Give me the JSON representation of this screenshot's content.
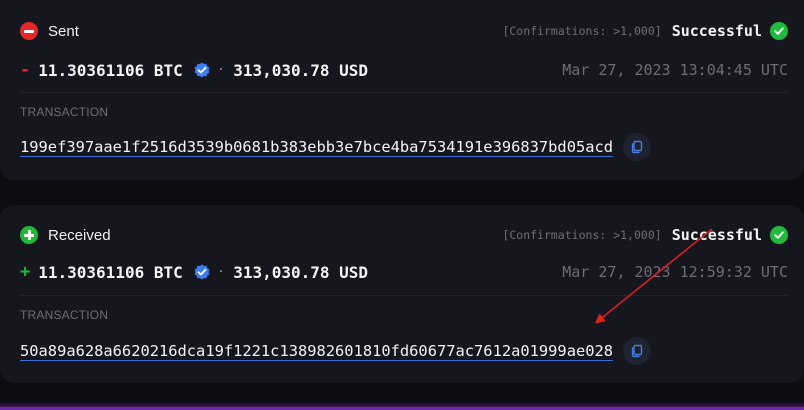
{
  "transactions": [
    {
      "direction_label": "Sent",
      "direction": "sent",
      "confirmations": "[Confirmations: >1,000]",
      "status": "Successful",
      "sign": "-",
      "amount": "11.30361106 BTC",
      "separator": "·",
      "fiat": "313,030.78 USD",
      "date": "Mar 27, 2023 13:04:45 UTC",
      "tx_label": "TRANSACTION",
      "tx_hash": "199ef397aae1f2516d3539b0681b383ebb3e7bce4ba7534191e396837bd05acd"
    },
    {
      "direction_label": "Received",
      "direction": "received",
      "confirmations": "[Confirmations: >1,000]",
      "status": "Successful",
      "sign": "+",
      "amount": "11.30361106 BTC",
      "separator": "·",
      "fiat": "313,030.78 USD",
      "date": "Mar 27, 2023 12:59:32 UTC",
      "tx_label": "TRANSACTION",
      "tx_hash": "50a89a628a6620216dca19f1221c138982601810fd60677ac7612a01999ae028"
    }
  ],
  "icons": {
    "sent": "minus-circle-icon",
    "received": "plus-circle-icon",
    "status": "check-circle-icon",
    "verified": "verified-badge-icon",
    "copy": "copy-icon"
  },
  "colors": {
    "sent": "#e5262b",
    "received": "#1fb83b",
    "success": "#22b93f",
    "verified": "#3b7ef0",
    "annotation_arrow": "#e0201f"
  }
}
